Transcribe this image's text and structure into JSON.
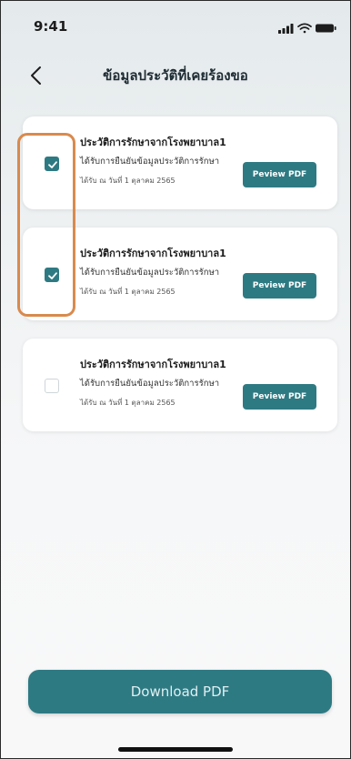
{
  "status_bar": {
    "time": "9:41",
    "icons": [
      "signal-icon",
      "wifi-icon",
      "battery-icon"
    ]
  },
  "nav": {
    "back_icon": "chevron-left-icon",
    "title": "ข้อมูลประวัติที่เคยร้องขอ"
  },
  "records": [
    {
      "title": "ประวัติการรักษาจากโรงพยาบาล1",
      "description": "ได้รับการยืนยันข้อมูลประวัติการรักษา",
      "date": "ได้รับ ณ วันที่ 1 ตุลาคม 2565",
      "preview_label": "Peview PDF",
      "checked": true
    },
    {
      "title": "ประวัติการรักษาจากโรงพยาบาล1",
      "description": "ได้รับการยืนยันข้อมูลประวัติการรักษา",
      "date": "ได้รับ ณ วันที่ 1 ตุลาคม 2565",
      "preview_label": "Peview PDF",
      "checked": true
    },
    {
      "title": "ประวัติการรักษาจากโรงพยาบาล1",
      "description": "ได้รับการยืนยันข้อมูลประวัติการรักษา",
      "date": "ได้รับ ณ วันที่ 1 ตุลาคม 2565",
      "preview_label": "Peview PDF",
      "checked": false
    }
  ],
  "download_label": "Download PDF",
  "colors": {
    "accent": "#2e7a83",
    "highlight": "#d98a4d"
  }
}
